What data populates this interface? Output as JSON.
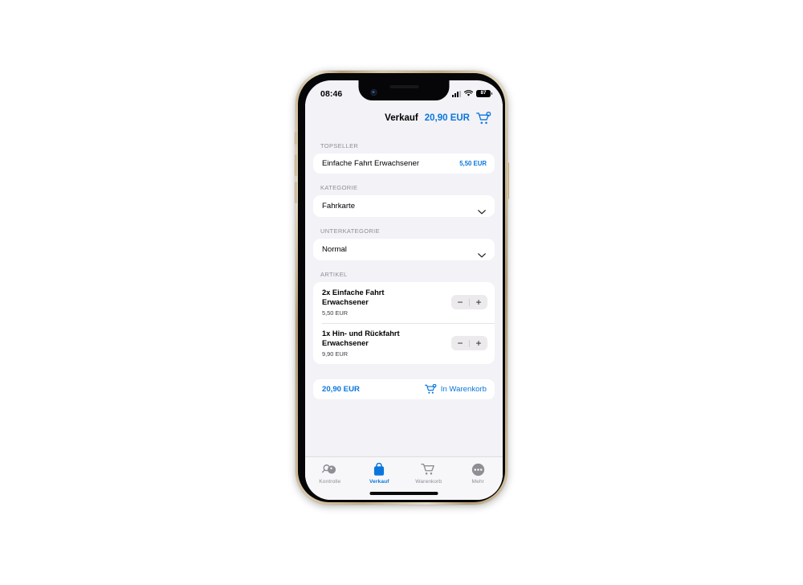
{
  "status_bar": {
    "time": "08:46",
    "battery_level": "87",
    "cellular_icon": "cellular-bars-icon",
    "wifi_icon": "wifi-icon",
    "battery_icon": "battery-icon"
  },
  "header": {
    "title": "Verkauf",
    "total": "20,90 EUR",
    "cart_icon": "cart-icon",
    "cart_badge_visible": true
  },
  "sections": {
    "topseller_label": "TOPSELLER",
    "kategorie_label": "KATEGORIE",
    "unterkategorie_label": "UNTERKATEGORIE",
    "artikel_label": "ARTIKEL"
  },
  "topseller": {
    "name": "Einfache Fahrt Erwachsener",
    "price": "5,50 EUR"
  },
  "kategorie": {
    "value": "Fahrkarte",
    "chevron_icon": "chevron-down-icon"
  },
  "unterkategorie": {
    "value": "Normal",
    "chevron_icon": "chevron-down-icon"
  },
  "artikel": [
    {
      "title": "2x Einfache Fahrt Erwachsener",
      "price": "5,50 EUR",
      "minus_label": "−",
      "plus_label": "+"
    },
    {
      "title": "1x Hin- und Rückfahrt Erwachsener",
      "price": "9,90 EUR",
      "minus_label": "−",
      "plus_label": "+"
    }
  ],
  "cart_bar": {
    "total": "20,90 EUR",
    "action_label": "In Warenkorb",
    "cart_icon": "cart-icon"
  },
  "tab_bar": {
    "items": [
      {
        "label": "Kontrolle",
        "icon": "control-scan-icon",
        "active": false
      },
      {
        "label": "Verkauf",
        "icon": "shopping-bag-icon",
        "active": true
      },
      {
        "label": "Warenkorb",
        "icon": "cart-icon",
        "active": false
      },
      {
        "label": "Mehr",
        "icon": "ellipsis-circle-icon",
        "active": false
      }
    ]
  },
  "colors": {
    "accent_blue": "#0a76dd",
    "background": "#f2f2f7",
    "card": "#ffffff",
    "muted_text": "#8e8e93",
    "device_frame": "#d4c4a0"
  }
}
